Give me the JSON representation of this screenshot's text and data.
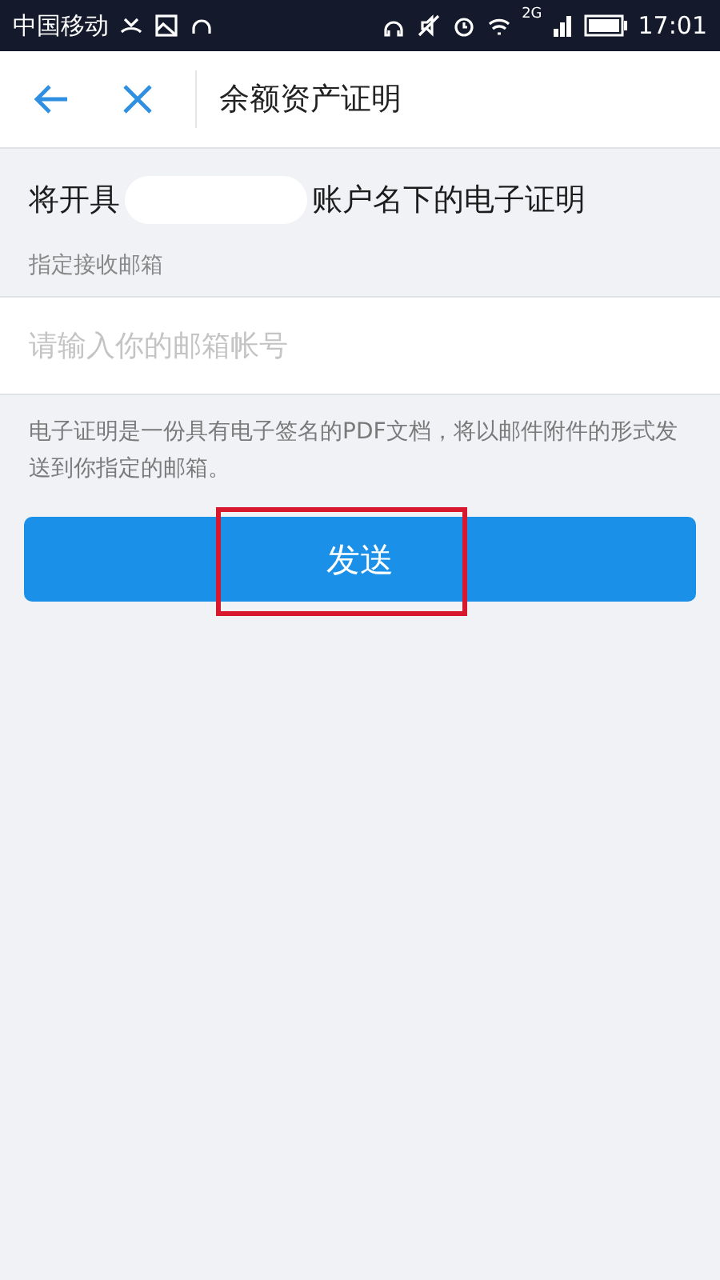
{
  "status_bar": {
    "carrier": "中国移动",
    "network": "2G",
    "time": "17:01"
  },
  "nav": {
    "title": "余额资产证明"
  },
  "heading": {
    "before": "将开具",
    "after": "账户名下的电子证明"
  },
  "email": {
    "label": "指定接收邮箱",
    "placeholder": "请输入你的邮箱帐号"
  },
  "note": "电子证明是一份具有电子签名的PDF文档，将以邮件附件的形式发送到你指定的邮箱。",
  "send_button": {
    "label": "发送",
    "highlighted": true
  }
}
